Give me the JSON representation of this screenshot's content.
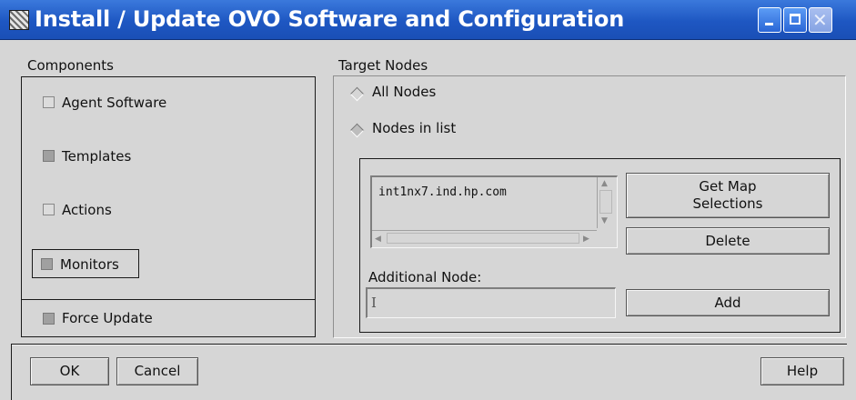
{
  "window": {
    "title": "Install / Update OVO Software and Configuration",
    "icon": "app-icon",
    "controls": [
      "minimize-icon",
      "maximize-icon",
      "close-icon"
    ]
  },
  "components": {
    "label": "Components",
    "items": [
      {
        "label": "Agent Software",
        "checked": false
      },
      {
        "label": "Templates",
        "checked": true
      },
      {
        "label": "Actions",
        "checked": false
      },
      {
        "label": "Monitors",
        "checked": true
      }
    ],
    "force_update_label": "Force Update"
  },
  "target_nodes": {
    "label": "Target Nodes",
    "radio_all_label": "All Nodes",
    "radio_list_label": "Nodes in list",
    "selected": "Nodes in list",
    "node_list": [
      "int1nx7.ind.hp.com"
    ],
    "get_map_selections_label": "Get Map\nSelections",
    "delete_label": "Delete",
    "additional_node_label": "Additional Node:",
    "additional_node_value": "",
    "add_label": "Add"
  },
  "footer": {
    "ok_label": "OK",
    "cancel_label": "Cancel",
    "help_label": "Help"
  },
  "colors": {
    "titlebar": "#1e57c2",
    "background": "#d6d6d6",
    "checkbox_checked": "#a0a0a0"
  }
}
